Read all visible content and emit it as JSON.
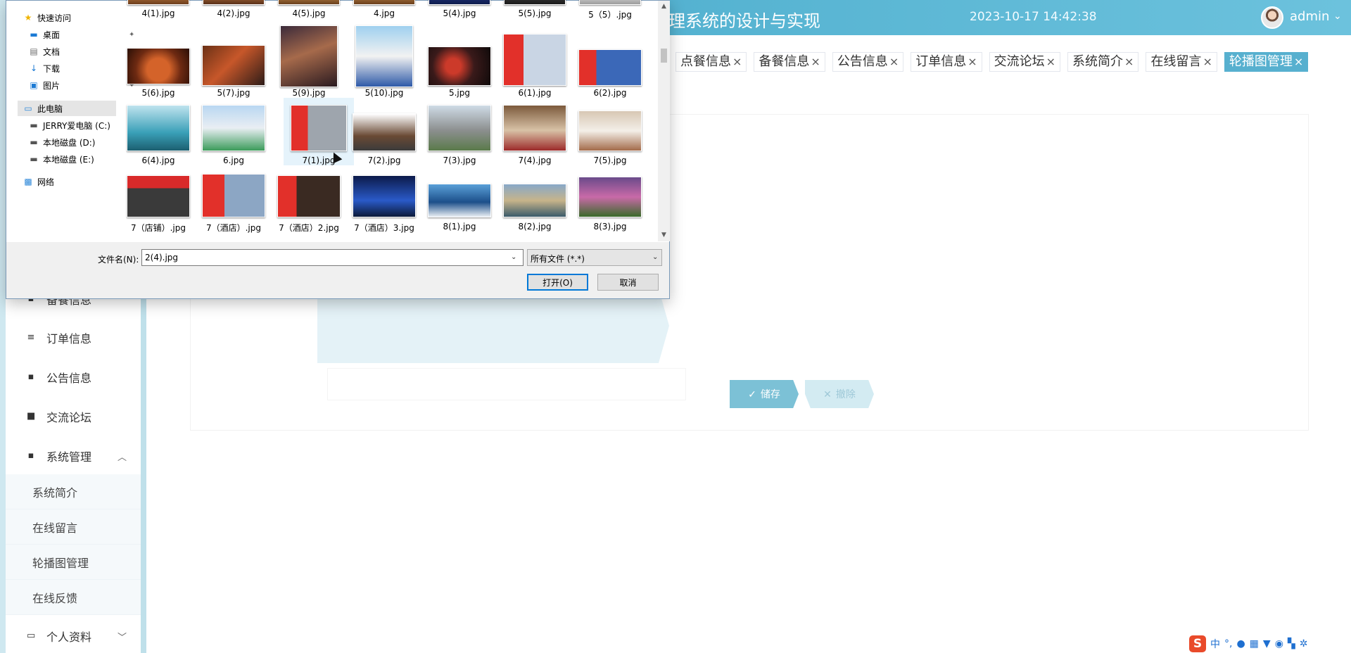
{
  "header": {
    "title": "理系统的设计与实现",
    "datetime": "2023-10-17 14:42:38",
    "username": "admin",
    "caret": "⌄"
  },
  "tabs": [
    {
      "label": "点餐信息",
      "close": "×"
    },
    {
      "label": "备餐信息",
      "close": "×"
    },
    {
      "label": "公告信息",
      "close": "×"
    },
    {
      "label": "订单信息",
      "close": "×"
    },
    {
      "label": "交流论坛",
      "close": "×"
    },
    {
      "label": "系统简介",
      "close": "×"
    },
    {
      "label": "在线留言",
      "close": "×"
    },
    {
      "label": "轮播图管理",
      "close": "×",
      "active": true
    }
  ],
  "form": {
    "save_label": "储存",
    "reset_label": "撤除",
    "save_icon": "✓",
    "reset_icon": "✕"
  },
  "sidebar": {
    "items": [
      {
        "label": "备餐信息",
        "icon": "grid-icon"
      },
      {
        "label": "订单信息",
        "icon": "list-icon"
      },
      {
        "label": "公告信息",
        "icon": "grid-icon"
      },
      {
        "label": "交流论坛",
        "icon": "monitor-icon"
      },
      {
        "label": "系统管理",
        "icon": "grid-icon",
        "expanded": true
      }
    ],
    "sub_items": [
      "系统简介",
      "在线留言",
      "轮播图管理",
      "在线反馈"
    ],
    "profile": {
      "label": "个人资料",
      "icon": "card-icon"
    }
  },
  "dialog": {
    "nav": {
      "quick_access": "快速访问",
      "desktop": "桌面",
      "documents": "文档",
      "downloads": "下载",
      "pictures": "图片",
      "this_pc": "此电脑",
      "drive_c": "JERRY爱电脑 (C:)",
      "drive_d": "本地磁盘 (D:)",
      "drive_e": "本地磁盘 (E:)",
      "network": "网络"
    },
    "files": [
      "4(1).jpg",
      "4(2).jpg",
      "4(5).jpg",
      "4.jpg",
      "5(4).jpg",
      "5(5).jpg",
      "5（5）.jpg",
      "5(6).jpg",
      "5(7).jpg",
      "5(9).jpg",
      "5(10).jpg",
      "5.jpg",
      "6(1).jpg",
      "6(2).jpg",
      "6(4).jpg",
      "6.jpg",
      "7(1).jpg",
      "7(2).jpg",
      "7(3).jpg",
      "7(4).jpg",
      "7(5).jpg",
      "7（店铺）.jpg",
      "7（酒店）.jpg",
      "7（酒店）2.jpg",
      "7（酒店）3.jpg",
      "8(1).jpg",
      "8(2).jpg",
      "8(3).jpg"
    ],
    "filename_label": "文件名(N):",
    "filename_value": "2(4).jpg",
    "filter_value": "所有文件 (*.*)",
    "open_label": "打开(O)",
    "cancel_label": "取消"
  },
  "colors": {
    "header_gradient_start": "#3a9fc2",
    "accent": "#57b0cf",
    "save_button": "#7cc1d6",
    "dialog_focus": "#0078d7"
  },
  "ime": {
    "brand": "S",
    "mode": "中",
    "icons": [
      "punct-icon",
      "mic-icon",
      "keyboard-icon",
      "shirt-icon",
      "emoji-icon",
      "grid-icon",
      "settings-icon"
    ]
  }
}
